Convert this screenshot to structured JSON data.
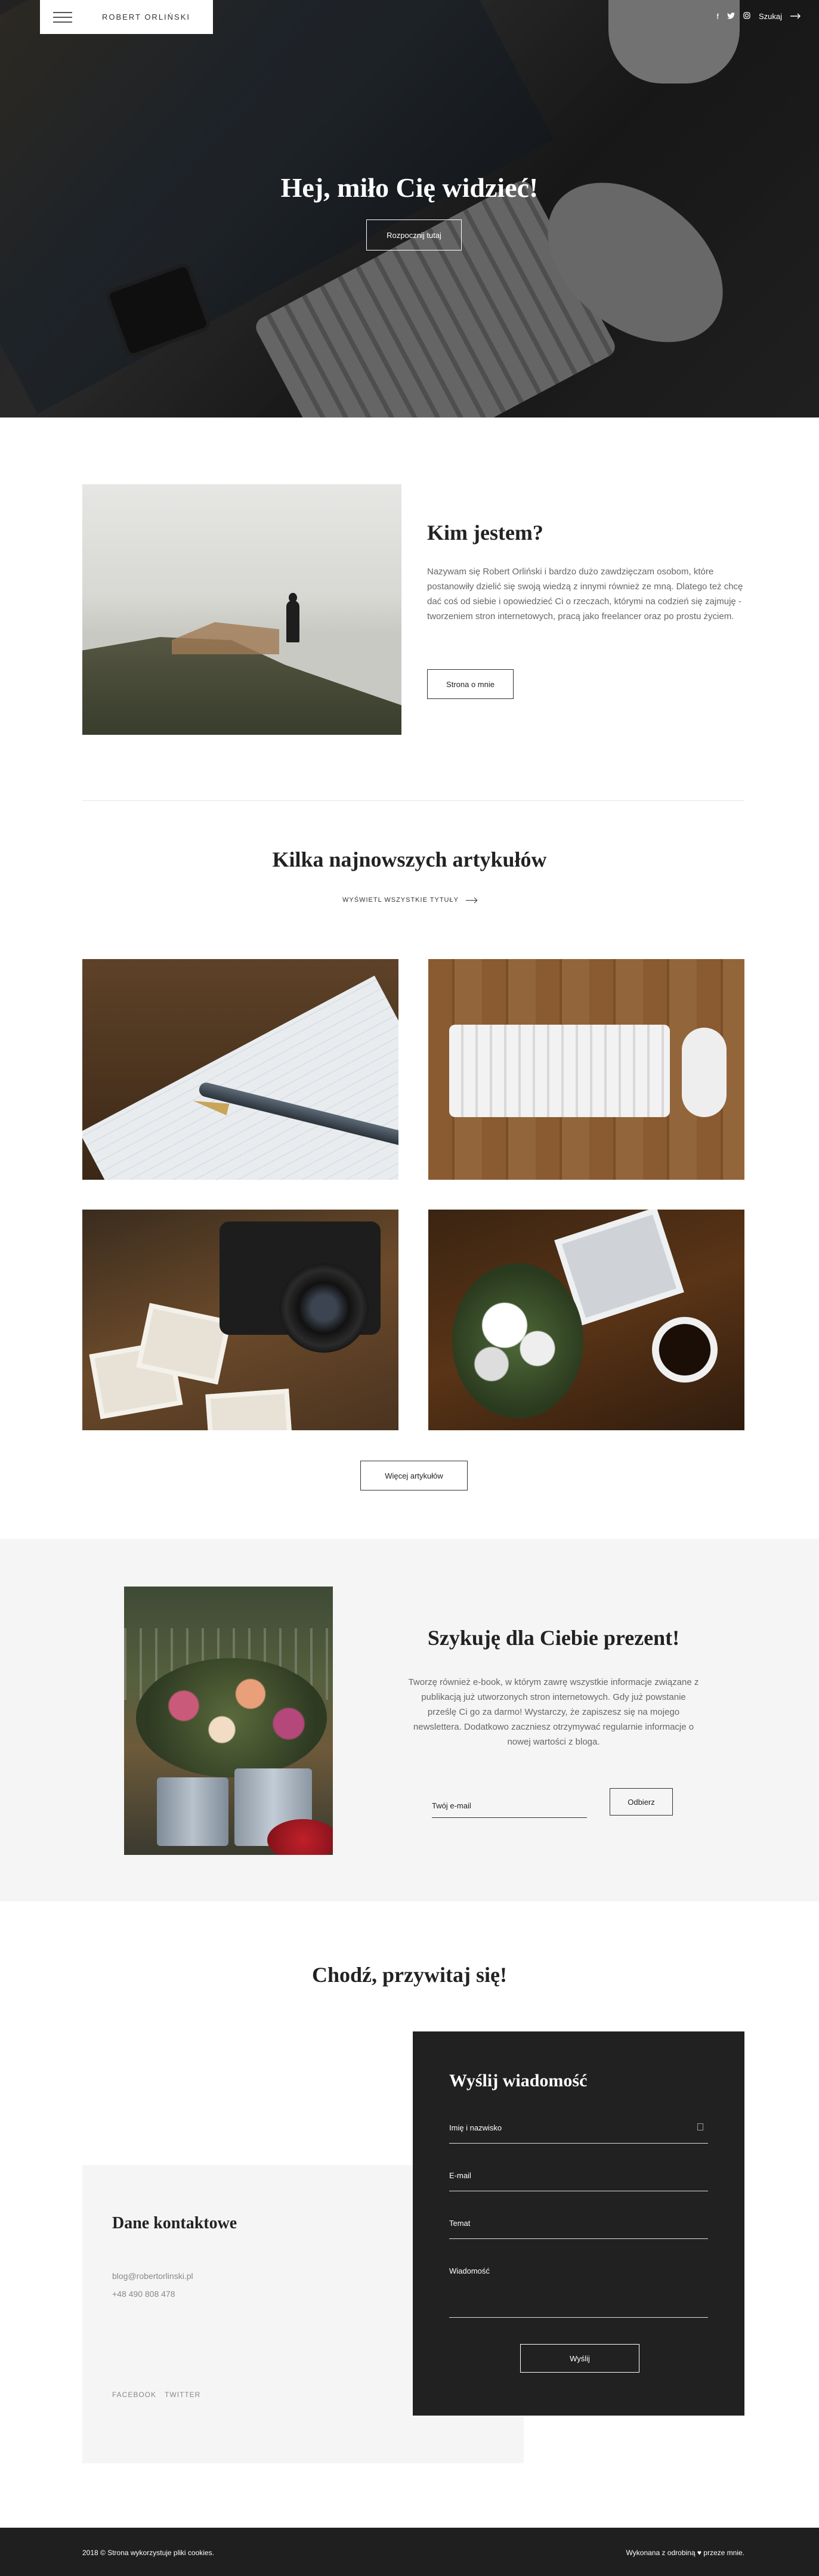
{
  "header": {
    "brand": "ROBERT ORLIŃSKI",
    "menu_icon": "hamburger-icon",
    "social_icons": [
      "facebook-icon",
      "twitter-icon",
      "instagram-icon"
    ],
    "search_label": "Szukaj",
    "search_icon": "arrow-right-icon"
  },
  "hero": {
    "title": "Hej, miło Cię widzieć!",
    "button": "Rozpocznij tutaj"
  },
  "about": {
    "title": "Kim jestem?",
    "text": "Nazywam się Robert Orliński i bardzo dużo zawdzięczam osobom, które postanowiły dzielić się swoją wiedzą z innymi również ze mną. Dlatego też chcę dać coś od siebie i opowiedzieć Ci o rzeczach, którymi na codzień się zajmuję - tworzeniem stron internetowych, pracą jako freelancer oraz po prostu życiem.",
    "button": "Strona o mnie"
  },
  "articles": {
    "title": "Kilka najnowszych artykułów",
    "view_all": "WYŚWIETL WSZYSTKIE TYTUŁY",
    "more_button": "Więcej artykułów"
  },
  "gift": {
    "title": "Szykuję dla Ciebie prezent!",
    "text": "Tworzę również e-book, w którym zawrę wszystkie informacje związane z publikacją już utworzonych stron internetowych. Gdy już powstanie prześlę Ci go za darmo! Wystarczy, że zapiszesz się na mojego newslettera. Dodatkowo zaczniesz otrzymywać regularnie informacje o nowej wartości z bloga.",
    "email_placeholder": "Twój e-mail",
    "button": "Odbierz"
  },
  "contact": {
    "title": "Chodź, przywitaj się!",
    "details_title": "Dane kontaktowe",
    "email": "blog@robertorlinski.pl",
    "phone": "+48 490 808 478",
    "social": [
      "FACEBOOK",
      "TWITTER"
    ],
    "form": {
      "title": "Wyślij wiadomość",
      "name_label": "Imię i nazwisko",
      "email_label": "E-mail",
      "subject_label": "Temat",
      "message_label": "Wiadomość",
      "submit": "Wyślij"
    }
  },
  "footer": {
    "left": "2018 © Strona wykorzystuje pliki cookies.",
    "right": "Wykonana z odrobiną ♥ przeze mnie."
  },
  "colors": {
    "hero_overlay": "#000000",
    "gift_bg": "#f5f5f5",
    "form_bg": "#212121",
    "footer_bg": "#1f1f1f"
  }
}
